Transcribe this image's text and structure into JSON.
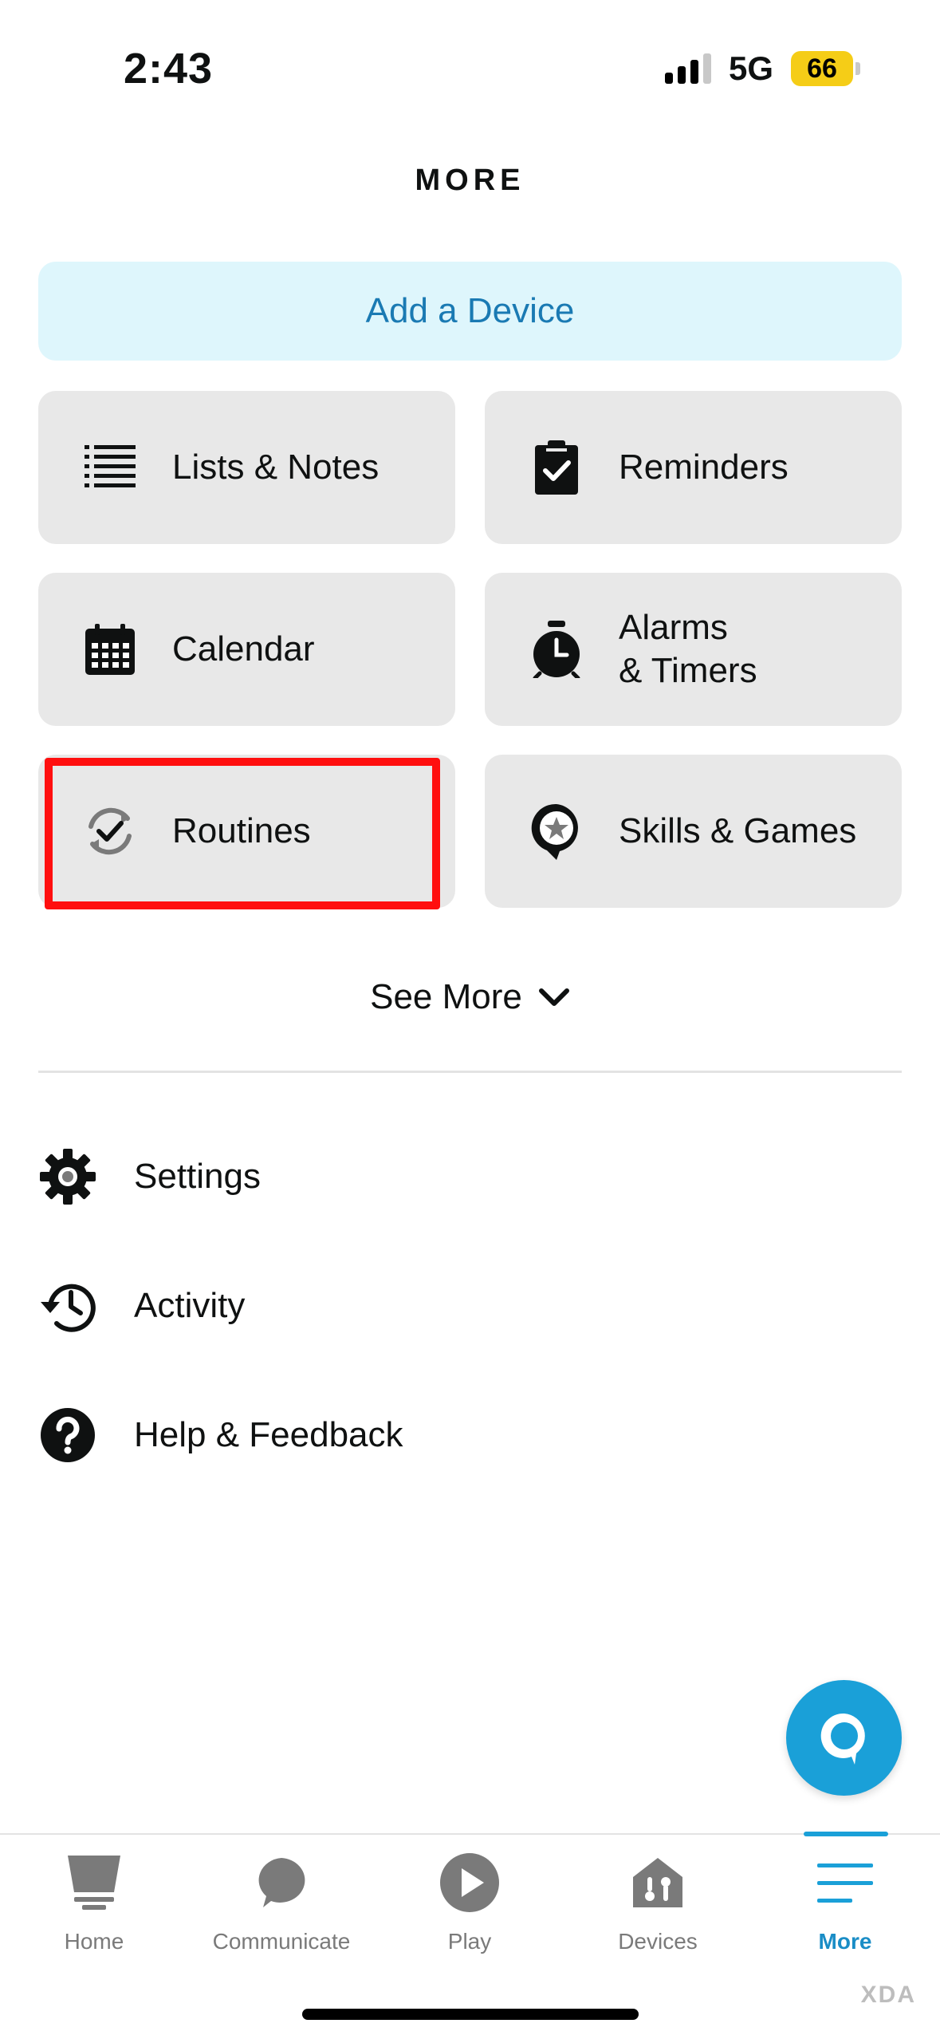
{
  "status_bar": {
    "time": "2:43",
    "network": "5G",
    "battery": "66"
  },
  "page": {
    "title": "MORE"
  },
  "add_device": {
    "label": "Add a Device"
  },
  "tiles": [
    {
      "label": "Lists & Notes",
      "icon": "list-icon"
    },
    {
      "label": "Reminders",
      "icon": "clipboard-check-icon"
    },
    {
      "label": "Calendar",
      "icon": "calendar-icon"
    },
    {
      "label": "Alarms\n& Timers",
      "icon": "alarm-clock-icon"
    },
    {
      "label": "Routines",
      "icon": "routine-check-icon"
    },
    {
      "label": "Skills & Games",
      "icon": "star-bubble-icon"
    }
  ],
  "see_more": {
    "label": "See More"
  },
  "list": [
    {
      "label": "Settings",
      "icon": "gear-icon"
    },
    {
      "label": "Activity",
      "icon": "history-icon"
    },
    {
      "label": "Help & Feedback",
      "icon": "help-icon"
    }
  ],
  "nav": [
    {
      "label": "Home",
      "icon": "home-icon"
    },
    {
      "label": "Communicate",
      "icon": "chat-icon"
    },
    {
      "label": "Play",
      "icon": "play-icon"
    },
    {
      "label": "Devices",
      "icon": "devices-icon"
    },
    {
      "label": "More",
      "icon": "menu-icon",
      "active": true
    }
  ],
  "watermark": "XDA",
  "colors": {
    "accent": "#1aa0d8",
    "accent_text": "#1a7ab3",
    "highlight": "#ff0f0f",
    "add_device_bg": "#def6fc",
    "tile_bg": "#e8e8e8"
  }
}
